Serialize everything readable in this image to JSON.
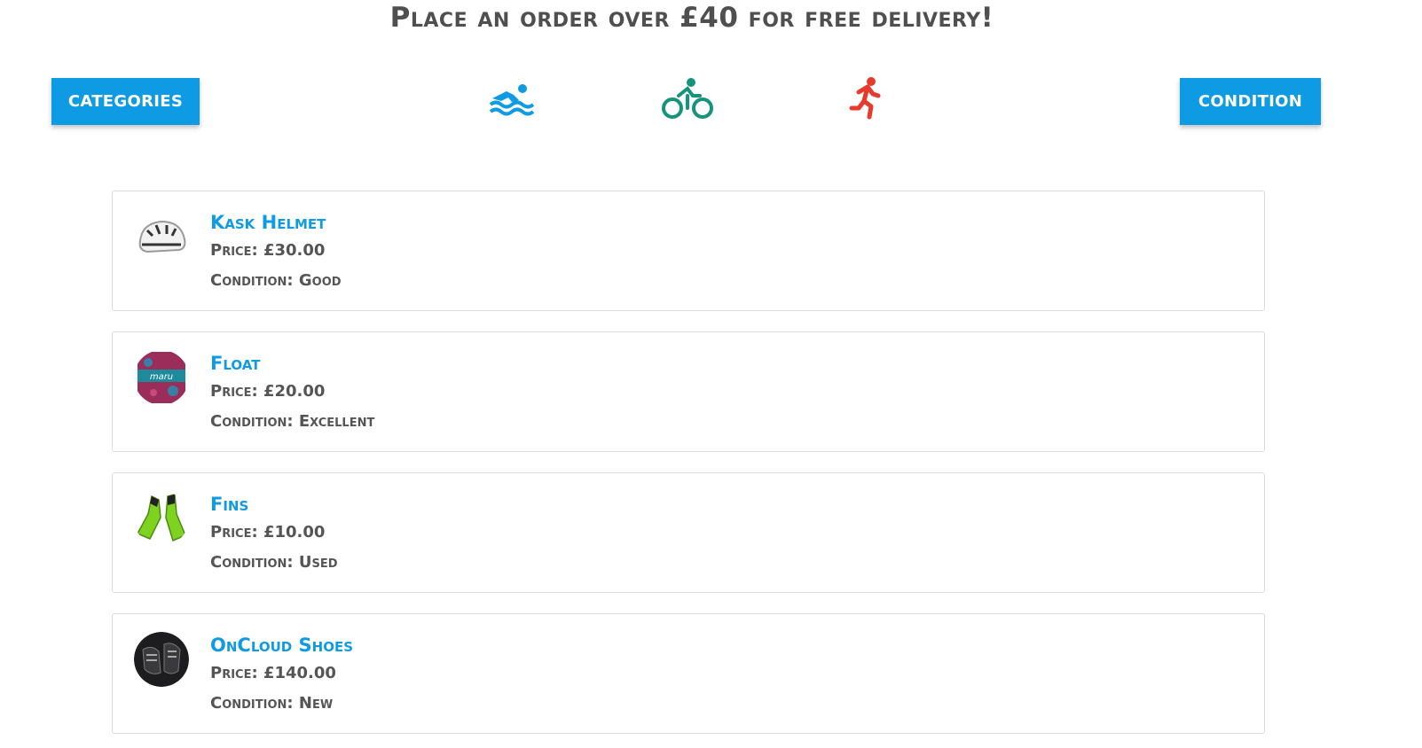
{
  "banner": {
    "text": "Place an order over £40 for free delivery!"
  },
  "toolbar": {
    "categories_label": "CATEGORIES",
    "condition_label": "CONDITION"
  },
  "sports": [
    {
      "icon": "swimming-icon",
      "color": "#0f9be3"
    },
    {
      "icon": "cycling-icon",
      "color": "#16937c"
    },
    {
      "icon": "running-icon",
      "color": "#e8392d"
    }
  ],
  "labels": {
    "price_prefix": "Price: ",
    "condition_prefix": "Condition: "
  },
  "products": [
    {
      "name": "Kask Helmet",
      "price": "£30.00",
      "condition": "Good",
      "image_icon": "helmet-image"
    },
    {
      "name": "Float",
      "price": "£20.00",
      "condition": "Excellent",
      "image_icon": "float-image"
    },
    {
      "name": "Fins",
      "price": "£10.00",
      "condition": "Used",
      "image_icon": "fins-image"
    },
    {
      "name": "OnCloud Shoes",
      "price": "£140.00",
      "condition": "New",
      "image_icon": "shoes-image"
    }
  ]
}
